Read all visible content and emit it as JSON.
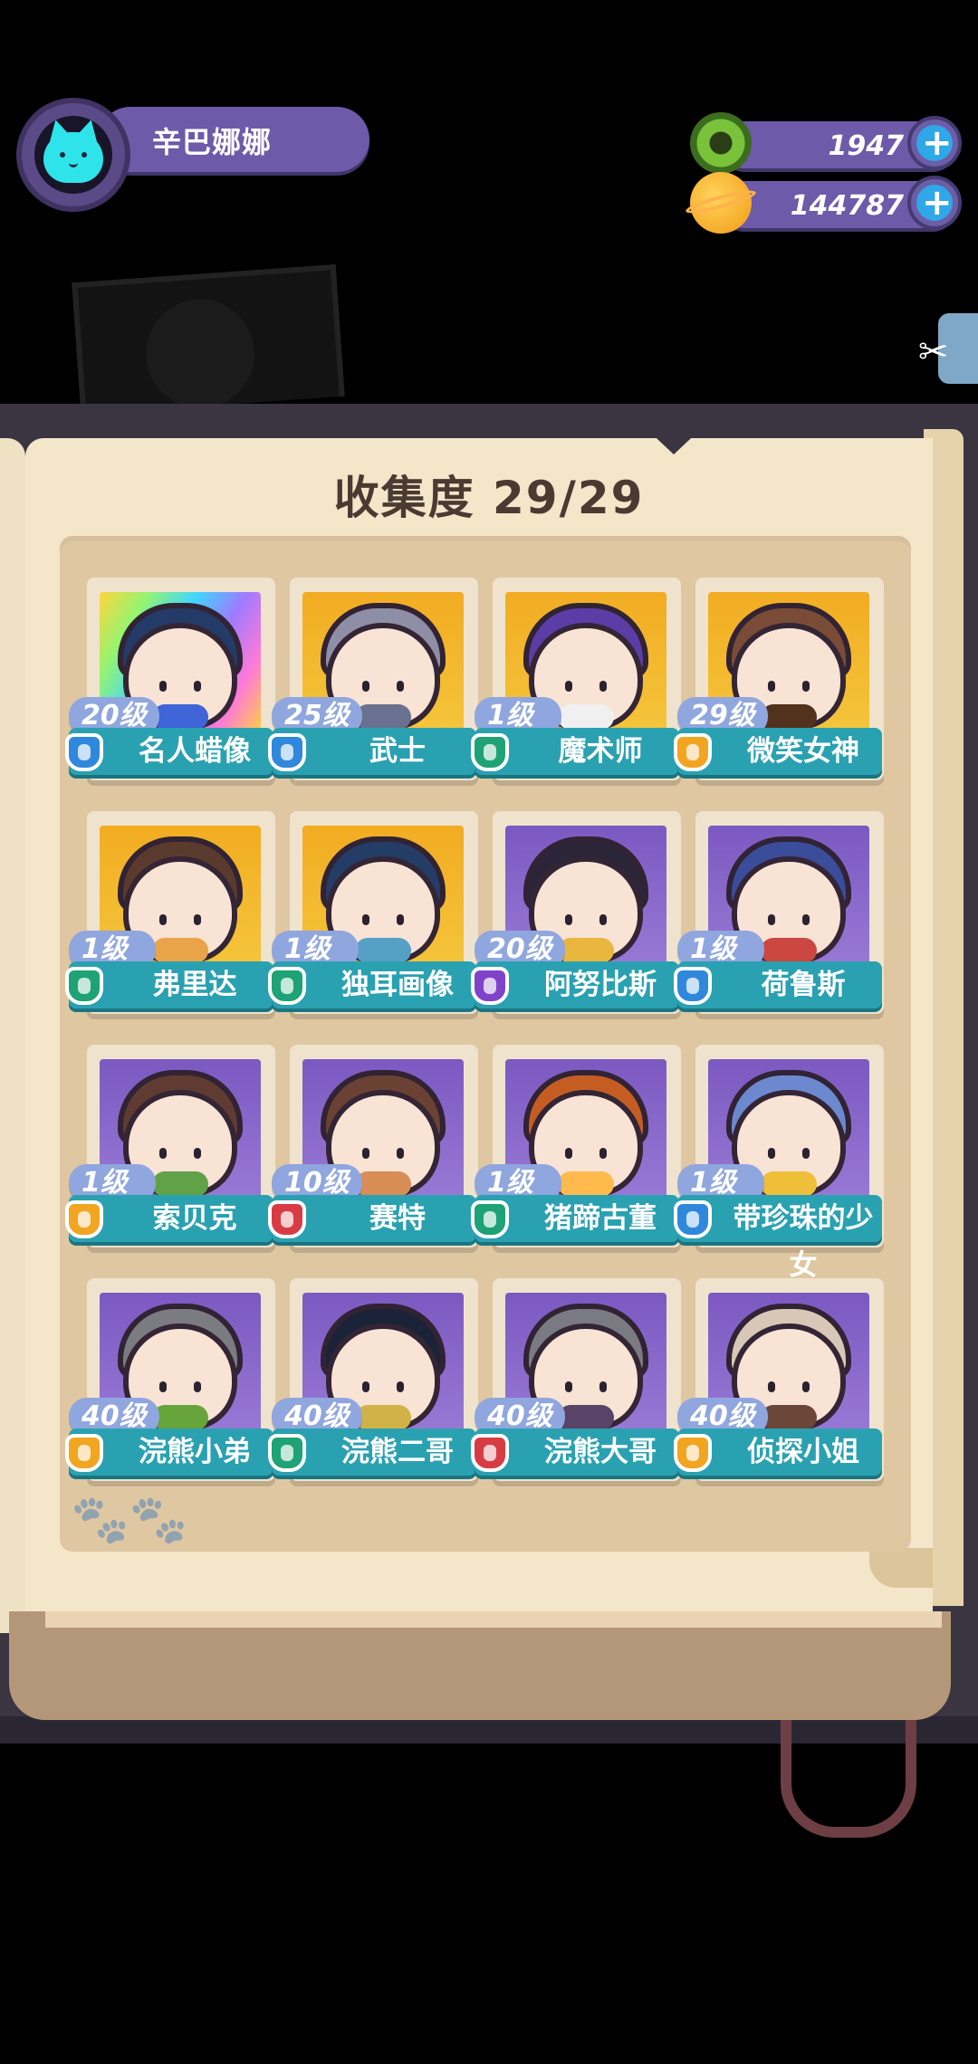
{
  "profile": {
    "player_name": "辛巴娜娜",
    "avatar_icon": "cyan-cat-avatar-icon"
  },
  "currencies": [
    {
      "icon": "green-donut-coin-icon",
      "value": "1947",
      "plus_label": "+"
    },
    {
      "icon": "orange-planet-coin-icon",
      "value": "144787",
      "plus_label": "+"
    }
  ],
  "book": {
    "title": "收集度 29/29",
    "background_icon": "paw-prints-icon",
    "side_button_icon": "scissors-icon"
  },
  "cards": [
    {
      "name": "名人蜡像",
      "level": "20级",
      "bg": "rainbow",
      "badge_color": "#2f88dc",
      "hair_color": "#233b66",
      "accent": "#3e64d8"
    },
    {
      "name": "武士",
      "level": "25级",
      "bg": "gold",
      "badge_color": "#2f88dc",
      "hair_color": "#8e8fa6",
      "accent": "#6a708f"
    },
    {
      "name": "魔术师",
      "level": "1级",
      "bg": "gold",
      "badge_color": "#1ea276",
      "hair_color": "#5b3da6",
      "accent": "#f0f0f0"
    },
    {
      "name": "微笑女神",
      "level": "29级",
      "bg": "gold",
      "badge_color": "#f2a521",
      "hair_color": "#7a4c38",
      "accent": "#53321d"
    },
    {
      "name": "弗里达",
      "level": "1级",
      "bg": "gold",
      "badge_color": "#1ea276",
      "hair_color": "#5a3a2d",
      "accent": "#e9a44a"
    },
    {
      "name": "独耳画像",
      "level": "1级",
      "bg": "gold",
      "badge_color": "#1ea276",
      "hair_color": "#243d66",
      "accent": "#56a0c6"
    },
    {
      "name": "阿努比斯",
      "level": "20级",
      "bg": "purple",
      "badge_color": "#7f43ca",
      "hair_color": "#2a2538",
      "accent": "#e9b63e"
    },
    {
      "name": "荷鲁斯",
      "level": "1级",
      "bg": "purple",
      "badge_color": "#2f88dc",
      "hair_color": "#3b4c9b",
      "accent": "#cb4740"
    },
    {
      "name": "索贝克",
      "level": "1级",
      "bg": "purple",
      "badge_color": "#f2a521",
      "hair_color": "#5f3b32",
      "accent": "#61a248"
    },
    {
      "name": "赛特",
      "level": "10级",
      "bg": "purple",
      "badge_color": "#d83c43",
      "hair_color": "#6a4132",
      "accent": "#d78d55"
    },
    {
      "name": "猪蹄古董",
      "level": "1级",
      "bg": "purple",
      "badge_color": "#1ea276",
      "hair_color": "#c55d23",
      "accent": "#ffba4d"
    },
    {
      "name": "带珍珠的少女",
      "level": "1级",
      "bg": "purple",
      "badge_color": "#2f88dc",
      "hair_color": "#6c89cf",
      "accent": "#f0bf39"
    },
    {
      "name": "浣熊小弟",
      "level": "40级",
      "bg": "purple",
      "badge_color": "#f2a521",
      "hair_color": "#7b7b82",
      "accent": "#67a53a"
    },
    {
      "name": "浣熊二哥",
      "level": "40级",
      "bg": "purple",
      "badge_color": "#1ea276",
      "hair_color": "#1b2339",
      "accent": "#d1b246"
    },
    {
      "name": "浣熊大哥",
      "level": "40级",
      "bg": "purple",
      "badge_color": "#d83c43",
      "hair_color": "#7a7b82",
      "accent": "#594366"
    },
    {
      "name": "侦探小姐",
      "level": "40级",
      "bg": "purple",
      "badge_color": "#f2a521",
      "hair_color": "#d8c6b7",
      "accent": "#6a4739"
    }
  ]
}
